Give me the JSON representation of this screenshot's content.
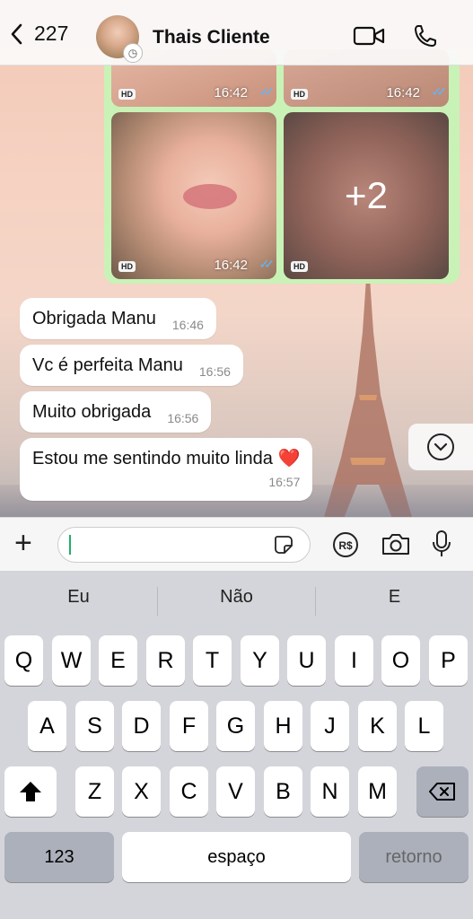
{
  "header": {
    "back_count": "227",
    "contact_name": "Thais Cliente"
  },
  "media": {
    "hd_label": "HD",
    "tiles": [
      {
        "time": "16:42",
        "ticks": "✓✓"
      },
      {
        "time": "16:42",
        "ticks": "✓✓"
      },
      {
        "time": "16:42",
        "ticks": "✓✓"
      },
      {
        "more": "+2"
      }
    ]
  },
  "messages": [
    {
      "text": "Obrigada Manu",
      "time": "16:46"
    },
    {
      "text": "Vc é perfeita Manu",
      "time": "16:56"
    },
    {
      "text": "Muito obrigada",
      "time": "16:56"
    },
    {
      "text": "Estou me sentindo muito linda ❤️",
      "time": "16:57"
    }
  ],
  "icons": {
    "back": "chevron-left-icon",
    "video": "video-call-icon",
    "phone": "phone-icon",
    "scroll": "chevron-down-circle-icon",
    "plus": "plus-icon",
    "sticker": "sticker-icon",
    "pix": "pix-payment-icon",
    "camera": "camera-icon",
    "mic": "microphone-icon",
    "shift": "shift-icon",
    "delete": "delete-icon"
  },
  "keyboard": {
    "suggestions": [
      "Eu",
      "Não",
      "E"
    ],
    "row1": [
      "Q",
      "W",
      "E",
      "R",
      "T",
      "Y",
      "U",
      "I",
      "O",
      "P"
    ],
    "row2": [
      "A",
      "S",
      "D",
      "F",
      "G",
      "H",
      "J",
      "K",
      "L"
    ],
    "row3": [
      "Z",
      "X",
      "C",
      "V",
      "B",
      "N",
      "M"
    ],
    "numbers_label": "123",
    "space_label": "espaço",
    "return_label": "retorno"
  },
  "colors": {
    "accent_green": "#1fae6a",
    "bubble_out": "#c9f2b7",
    "read_ticks": "#5cb8ff"
  }
}
